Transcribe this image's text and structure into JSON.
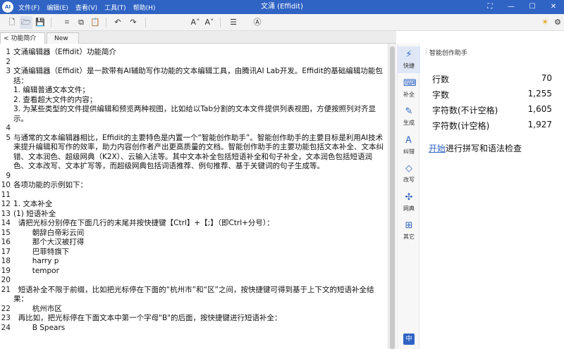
{
  "app": {
    "logo": "AI",
    "title": "文涌 (Effidit)",
    "menu": [
      "文件(F)",
      "编辑(E)",
      "查看(V)",
      "工具(T)",
      "帮助(H)"
    ]
  },
  "window_controls": [
    "⛶",
    "—",
    "☐",
    "✕"
  ],
  "toolbar": {
    "icons": [
      "new-file-icon",
      "open-folder-icon",
      "save-icon",
      "crop-icon",
      "copy-icon",
      "paste-icon",
      "undo-icon",
      "redo-icon",
      "increase-font-icon",
      "decrease-font-icon",
      "format-icon",
      "ai-assistant-icon"
    ],
    "right_icons": [
      "sun-icon",
      "settings-icon"
    ]
  },
  "tabs": [
    {
      "label": "< 功能简介",
      "close": "✕"
    },
    {
      "label": "New",
      "close": "✕"
    }
  ],
  "editor_lines": [
    {
      "n": "1",
      "t": "文涌编辑器（Effidit）功能简介"
    },
    {
      "n": "2",
      "t": ""
    },
    {
      "n": "3",
      "t": "文涌编辑器（Effidit）是一款带有AI辅助写作功能的文本编辑工具，由腾讯AI Lab开发。Effidit的基础编辑功能包括："
    },
    {
      "n": "",
      "t": "1. 编辑普通文本文件；"
    },
    {
      "n": "",
      "t": "2. 查看超大文件的内容；"
    },
    {
      "n": "",
      "t": "3. 为某些类型的文件提供编辑和预览两种视图，比如给以Tab分割的文本文件提供列表视图，方便按照列对齐显示。"
    },
    {
      "n": "4",
      "t": ""
    },
    {
      "n": "5",
      "t": "与通常的文本编辑器相比，Effidit的主要特色是内置一个“智能创作助手”。智能创作助手的主要目标是利用AI技术来提升编辑和写作的效率，助力内容创作者产出更高质量的文档。智能创作助手的主要功能包括文本补全、文本纠错、文本润色、超级网典（K2X）、云输入法等。其中文本补全包括短语补全和句子补全，文本润色包括短语润色、文本改写、文本扩写等，而超级网典包括词语推荐、例句推荐、基于关键词的句子生成等。"
    },
    {
      "n": "9",
      "t": ""
    },
    {
      "n": "10",
      "t": "各项功能的示例如下："
    },
    {
      "n": "11",
      "t": ""
    },
    {
      "n": "12",
      "t": "1. 文本补全"
    },
    {
      "n": "13",
      "t": "(1) 短语补全"
    },
    {
      "n": "14",
      "t": "  请把光标分别停在下面几行的末尾并按快捷键【Ctrl】+【;】（即Ctrl+分号）："
    },
    {
      "n": "15",
      "t": "        朝辞白帝彩云间"
    },
    {
      "n": "16",
      "t": "        那个大汉被打得"
    },
    {
      "n": "17",
      "t": "        巴菲特旗下"
    },
    {
      "n": "18",
      "t": "        harry p"
    },
    {
      "n": "19",
      "t": "        tempor"
    },
    {
      "n": "20",
      "t": ""
    },
    {
      "n": "21",
      "t": "  短语补全不限于前缀，比如把光标停在下面的“杭州市”和“区”之间，按快捷键可得到基于上下文的短语补全结果："
    },
    {
      "n": "22",
      "t": "        杭州市区"
    },
    {
      "n": "23",
      "t": "  再比如，把光标停在下面文本中第一个字母\"B\"的后面，按快捷键进行短语补全："
    },
    {
      "n": "24",
      "t": "        B Spears"
    }
  ],
  "sidebar": [
    {
      "icon": "⚡",
      "label": "快捷",
      "name": "sidebar-item-shortcut",
      "icon_name": "lightning-icon"
    },
    {
      "icon": "⌨",
      "label": "补全",
      "name": "sidebar-item-complete",
      "icon_name": "keyboard-icon"
    },
    {
      "icon": "✎",
      "label": "生成",
      "name": "sidebar-item-generate",
      "icon_name": "document-edit-icon"
    },
    {
      "icon": "Ꭺ",
      "label": "纠错",
      "name": "sidebar-item-correct",
      "icon_name": "spellcheck-icon"
    },
    {
      "icon": "◇",
      "label": "改写",
      "name": "sidebar-item-rewrite",
      "icon_name": "diamond-icon"
    },
    {
      "icon": "✣",
      "label": "网典",
      "name": "sidebar-item-dictionary",
      "icon_name": "network-icon"
    },
    {
      "icon": "⊞",
      "label": "其它",
      "name": "sidebar-item-other",
      "icon_name": "grid-icon"
    }
  ],
  "sidebar_bottom": "中",
  "panel": {
    "title": "智能创作助手",
    "stats": [
      {
        "label": "行数",
        "value": "70"
      },
      {
        "label": "字数",
        "value": "1,255"
      },
      {
        "label": "字符数(不计空格)",
        "value": "1,605"
      },
      {
        "label": "字符数(计空格)",
        "value": "1,927"
      }
    ],
    "check_link": "开始",
    "check_text": "进行拼写和语法检查"
  }
}
